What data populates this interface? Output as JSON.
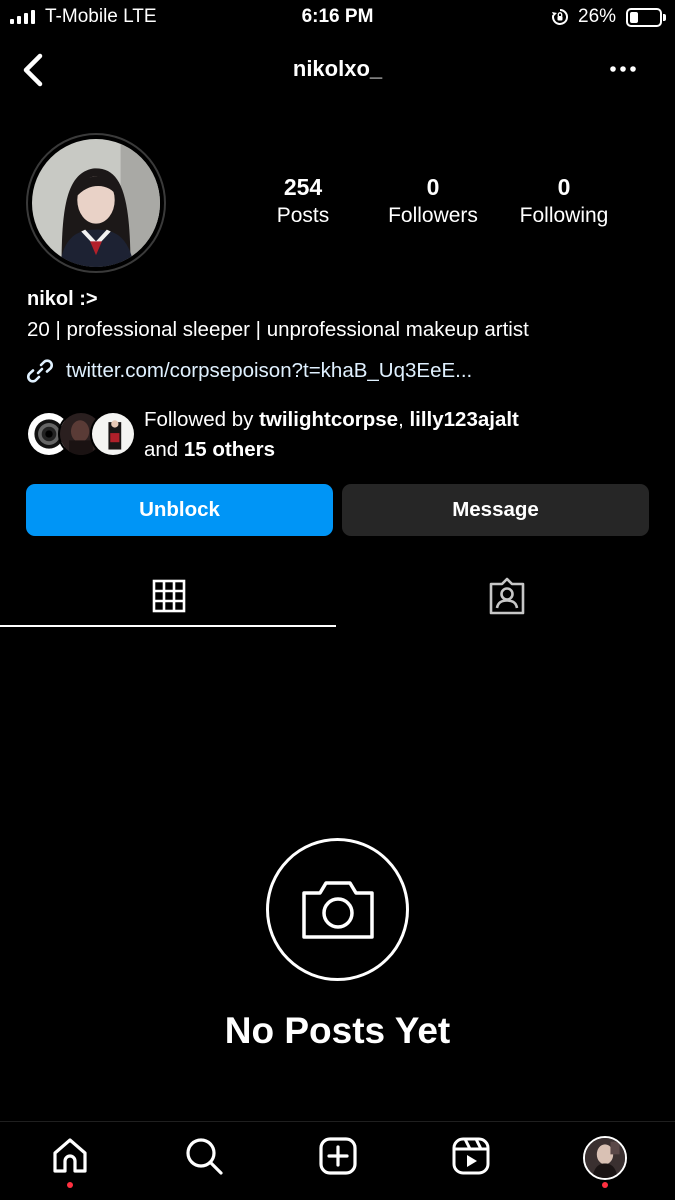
{
  "status_bar": {
    "carrier": "T-Mobile  LTE",
    "time": "6:16 PM",
    "battery": "26%"
  },
  "header": {
    "username": "nikolxo_",
    "back_icon": "chevron-left-icon",
    "more_icon": "more-horizontal-icon"
  },
  "profile": {
    "stats": {
      "posts_count": "254",
      "posts_label": "Posts",
      "followers_count": "0",
      "followers_label": "Followers",
      "following_count": "0",
      "following_label": "Following"
    },
    "display_name": "nikol :>",
    "bio": "20 | professional sleeper | unprofessional makeup artist",
    "link": "twitter.com/corpsepoison?t=khaB_Uq3EeE...",
    "followed_by": {
      "prefix": "Followed by ",
      "user1": "twilightcorpse",
      "sep": ", ",
      "user2": "lilly123ajalt",
      "and": "and ",
      "others": "15 others"
    }
  },
  "actions": {
    "unblock_label": "Unblock",
    "message_label": "Message"
  },
  "tabs": [
    {
      "name": "grid",
      "icon": "grid-icon",
      "active": true
    },
    {
      "name": "tagged",
      "icon": "tagged-person-icon",
      "active": false
    }
  ],
  "empty_state": {
    "icon": "camera-icon",
    "title": "No Posts Yet"
  },
  "bottom_nav": [
    {
      "name": "home",
      "icon": "home-icon",
      "dot": true
    },
    {
      "name": "search",
      "icon": "search-icon",
      "dot": false
    },
    {
      "name": "create",
      "icon": "plus-square-icon",
      "dot": false
    },
    {
      "name": "reels",
      "icon": "reels-icon",
      "dot": false
    },
    {
      "name": "profile",
      "icon": "profile-avatar",
      "dot": true
    }
  ],
  "colors": {
    "background": "#000000",
    "primary_button": "#0095f6",
    "secondary_button": "#262626",
    "notification_dot": "#ff3040"
  }
}
